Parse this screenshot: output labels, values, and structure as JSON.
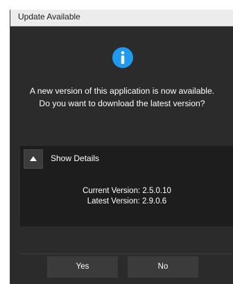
{
  "dialog": {
    "title": "Update Available",
    "icon": "info-icon",
    "message_line1": "A new version of this application is now available.",
    "message_line2": "Do you want to download the latest version?"
  },
  "details": {
    "toggle_icon": "triangle-up-icon",
    "toggle_label": "Show Details",
    "current_version": "Current Version: 2.5.0.10",
    "latest_version": "Latest Version: 2.9.0.6"
  },
  "buttons": {
    "yes_label": "Yes",
    "no_label": "No"
  },
  "colors": {
    "dialog_background": "#2b2b2b",
    "details_background": "#1d1d1d",
    "button_background": "#3b3b3b",
    "info_icon": "#1e9bf0",
    "title_bar": "#ececec"
  }
}
